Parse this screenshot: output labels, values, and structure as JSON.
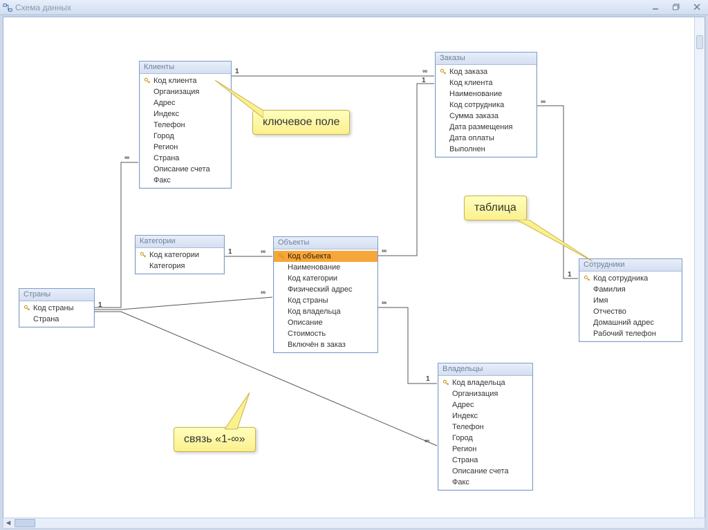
{
  "window": {
    "title": "Схема данных"
  },
  "tables": {
    "clients": {
      "title": "Клиенты",
      "fields": [
        "Код клиента",
        "Организация",
        "Адрес",
        "Индекс",
        "Телефон",
        "Город",
        "Регион",
        "Страна",
        "Описание счета",
        "Факс"
      ],
      "keys": [
        0
      ]
    },
    "orders": {
      "title": "Заказы",
      "fields": [
        "Код заказа",
        "Код клиента",
        "Наименование",
        "Код сотрудника",
        "Сумма заказа",
        "Дата размещения",
        "Дата оплаты",
        "Выполнен"
      ],
      "keys": [
        0
      ]
    },
    "categories": {
      "title": "Категории",
      "fields": [
        "Код категории",
        "Категория"
      ],
      "keys": [
        0
      ]
    },
    "countries": {
      "title": "Страны",
      "fields": [
        "Код страны",
        "Страна"
      ],
      "keys": [
        0
      ]
    },
    "objects": {
      "title": "Объекты",
      "fields": [
        "Код объекта",
        "Наименование",
        "Код категории",
        "Физический адрес",
        "Код страны",
        "Код владельца",
        "Описание",
        "Стоимость",
        "Включён в заказ"
      ],
      "keys": [
        0
      ],
      "selected": 0
    },
    "employees": {
      "title": "Сотрудники",
      "fields": [
        "Код сотрудника",
        "Фамилия",
        "Имя",
        "Отчество",
        "Домашний адрес",
        "Рабочий телефон"
      ],
      "keys": [
        0
      ]
    },
    "owners": {
      "title": "Владельцы",
      "fields": [
        "Код владельца",
        "Организация",
        "Адрес",
        "Индекс",
        "Телефон",
        "Город",
        "Регион",
        "Страна",
        "Описание счета",
        "Факс"
      ],
      "keys": [
        0
      ]
    }
  },
  "callouts": {
    "key_field": "ключевое поле",
    "table_label": "таблица",
    "relation": "связь «1-∞»"
  },
  "symbols": {
    "one": "1",
    "many": "∞"
  }
}
